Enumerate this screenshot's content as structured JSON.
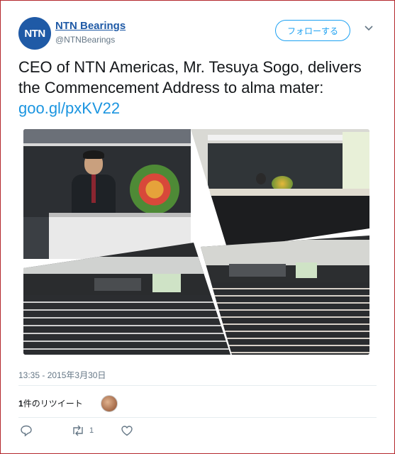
{
  "account": {
    "avatar_text": "NTN",
    "name": "NTN Bearings",
    "handle": "@NTNBearings",
    "follow_label": "フォローする"
  },
  "tweet": {
    "text": "CEO of NTN Americas, Mr. Tesuya Sogo, delivers the Commencement Address to alma mater: ",
    "link": "goo.gl/pxKV22",
    "timestamp": "13:35 - 2015年3月30日"
  },
  "stats": {
    "retweet_count": "1",
    "retweet_label": "件のリツイート"
  },
  "actions": {
    "retweet_count": "1"
  },
  "colors": {
    "brand": "#1f5aa6",
    "accent": "#1da1f2",
    "link": "#1b95e0",
    "frame": "#b3272d"
  },
  "icons": [
    "chevron-down-icon",
    "reply-icon",
    "retweet-icon",
    "like-icon"
  ]
}
